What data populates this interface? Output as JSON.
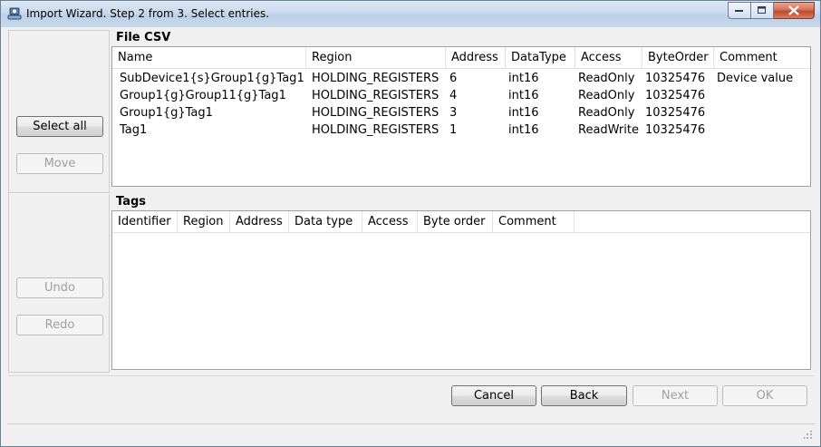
{
  "window": {
    "title": "Import Wizard. Step 2 from 3. Select entries."
  },
  "left_pane": {
    "select_all_label": "Select all",
    "move_label": "Move",
    "undo_label": "Undo",
    "redo_label": "Redo"
  },
  "csv_group": {
    "title": "File CSV",
    "columns": [
      "Name",
      "Region",
      "Address",
      "DataType",
      "Access",
      "ByteOrder",
      "Comment"
    ],
    "rows": [
      [
        "SubDevice1{s}Group1{g}Tag1",
        "HOLDING_REGISTERS",
        "6",
        "int16",
        "ReadOnly",
        "10325476",
        "Device value"
      ],
      [
        "Group1{g}Group11{g}Tag1",
        "HOLDING_REGISTERS",
        "4",
        "int16",
        "ReadOnly",
        "10325476",
        ""
      ],
      [
        "Group1{g}Tag1",
        "HOLDING_REGISTERS",
        "3",
        "int16",
        "ReadOnly",
        "10325476",
        ""
      ],
      [
        "Tag1",
        "HOLDING_REGISTERS",
        "1",
        "int16",
        "ReadWrite",
        "10325476",
        ""
      ]
    ]
  },
  "tags_group": {
    "title": "Tags",
    "columns": [
      "Identifier",
      "Region",
      "Address",
      "Data type",
      "Access",
      "Byte order",
      "Comment"
    ]
  },
  "footer": {
    "cancel_label": "Cancel",
    "back_label": "Back",
    "next_label": "Next",
    "ok_label": "OK"
  }
}
